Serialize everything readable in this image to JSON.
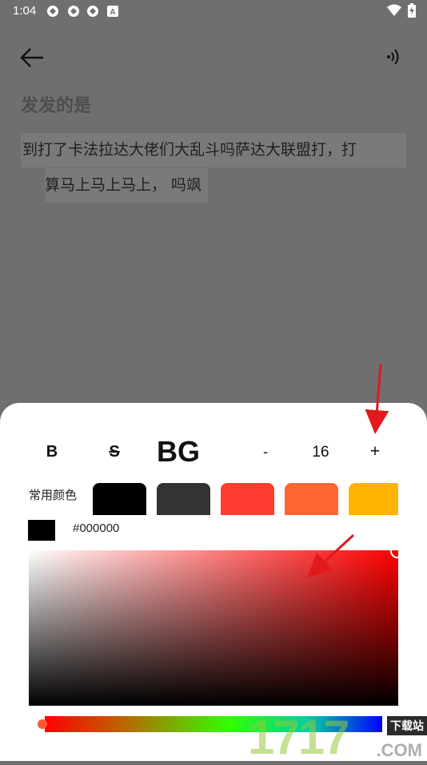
{
  "status_bar": {
    "time": "1:04",
    "notification_icons": [
      "vpn-app-icon",
      "vpn-app-icon",
      "vpn-app-icon",
      "a-box-icon"
    ],
    "right_icons": [
      "wifi-icon",
      "battery-charging-icon"
    ]
  },
  "app_bar": {
    "back_icon": "arrow-left-icon",
    "tts_icon": "text-to-speech-icon"
  },
  "document": {
    "title": "发发的是",
    "line1": "到打了卡法拉达大佬们大乱斗吗萨达大联盟打，打",
    "line2": "算马上马上马上， 吗飒"
  },
  "format_toolbar": {
    "bold_label": "B",
    "strike_label": "S",
    "background_label": "BG",
    "decrease_label": "-",
    "font_size": "16",
    "increase_label": "+"
  },
  "color_picker": {
    "common_colors_label": "常用颜色",
    "swatches": [
      "#000000",
      "#333333",
      "#ff3b2f",
      "#ff6530",
      "#ffb300"
    ],
    "current_color": "#000000",
    "current_hex": "#000000"
  },
  "watermark": {
    "digits": "1717",
    "suffix": ".COM",
    "site_label": "下载站"
  }
}
